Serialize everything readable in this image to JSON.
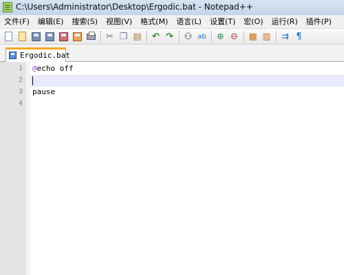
{
  "window": {
    "title": "C:\\Users\\Administrator\\Desktop\\Ergodic.bat - Notepad++"
  },
  "menu": {
    "items": [
      "文件(F)",
      "编辑(E)",
      "搜索(S)",
      "视图(V)",
      "格式(M)",
      "语言(L)",
      "设置(T)",
      "宏(O)",
      "运行(R)",
      "插件(P)"
    ]
  },
  "toolbar": {
    "icons": [
      "new-file-icon",
      "open-file-icon",
      "save-icon",
      "save-all-icon",
      "close-icon",
      "close-all-icon",
      "print-icon",
      "cut-icon",
      "copy-icon",
      "paste-icon",
      "undo-icon",
      "redo-icon",
      "find-icon",
      "replace-icon",
      "zoom-in-icon",
      "zoom-out-icon",
      "sync-vertical-icon",
      "sync-horizontal-icon",
      "word-wrap-icon",
      "show-all-chars-icon"
    ]
  },
  "tabs": [
    {
      "label": "Ergodic.bat",
      "active": true
    }
  ],
  "editor": {
    "lines": [
      {
        "number": "1",
        "prefix": "@",
        "text": "echo off"
      },
      {
        "number": "2",
        "prefix": "",
        "text": ""
      },
      {
        "number": "3",
        "prefix": "",
        "text": "pause"
      },
      {
        "number": "4",
        "prefix": "",
        "text": ""
      }
    ],
    "current_line": 2
  },
  "colors": {
    "tab_accent": "#f5a623",
    "current_line_bg": "#e8e8ff",
    "at_sign": "#7f4fbf"
  }
}
